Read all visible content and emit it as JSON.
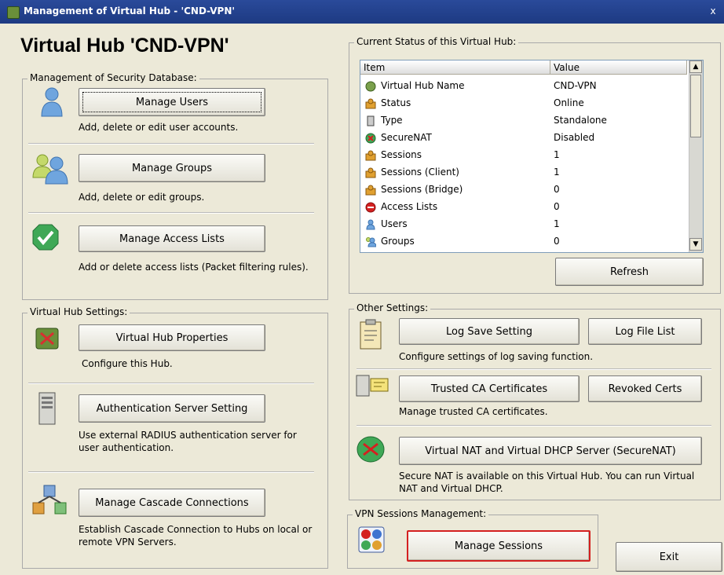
{
  "window": {
    "title": "Management of Virtual Hub - 'CND-VPN'",
    "close": "x"
  },
  "hub_title": "Virtual Hub 'CND-VPN'",
  "security": {
    "legend": "Management of Security Database:",
    "manage_users": "Manage Users",
    "manage_users_desc": "Add, delete or edit user accounts.",
    "manage_groups": "Manage Groups",
    "manage_groups_desc": "Add, delete or edit groups.",
    "manage_acl": "Manage Access Lists",
    "manage_acl_desc": "Add or delete access lists (Packet filtering rules)."
  },
  "hub_settings": {
    "legend": "Virtual Hub Settings:",
    "properties": "Virtual Hub Properties",
    "properties_desc": "Configure this Hub.",
    "auth_server": "Authentication Server Setting",
    "auth_server_desc": "Use external RADIUS authentication server for user authentication.",
    "cascade": "Manage Cascade Connections",
    "cascade_desc": "Establish Cascade Connection to Hubs on local or remote VPN Servers."
  },
  "status": {
    "legend": "Current Status of this Virtual Hub:",
    "col_item": "Item",
    "col_value": "Value",
    "rows": [
      {
        "item": "Virtual Hub Name",
        "value": "CND-VPN",
        "icon": "hub-icon"
      },
      {
        "item": "Status",
        "value": "Online",
        "icon": "status-icon"
      },
      {
        "item": "Type",
        "value": "Standalone",
        "icon": "server-icon"
      },
      {
        "item": "SecureNAT",
        "value": "Disabled",
        "icon": "securenat-icon"
      },
      {
        "item": "Sessions",
        "value": "1",
        "icon": "sessions-icon"
      },
      {
        "item": "Sessions (Client)",
        "value": "1",
        "icon": "sessions-icon"
      },
      {
        "item": "Sessions (Bridge)",
        "value": "0",
        "icon": "sessions-icon"
      },
      {
        "item": "Access Lists",
        "value": "0",
        "icon": "no-entry-icon"
      },
      {
        "item": "Users",
        "value": "1",
        "icon": "user-icon"
      },
      {
        "item": "Groups",
        "value": "0",
        "icon": "group-icon"
      }
    ],
    "refresh": "Refresh"
  },
  "other": {
    "legend": "Other Settings:",
    "log_save": "Log Save Setting",
    "log_file_list": "Log File List",
    "log_desc": "Configure settings of log saving function.",
    "trusted_ca": "Trusted CA Certificates",
    "revoked": "Revoked Certs",
    "trusted_desc": "Manage trusted CA certificates.",
    "securenat": "Virtual NAT and Virtual DHCP Server (SecureNAT)",
    "securenat_desc": "Secure NAT is available on this Virtual Hub. You can run Virtual NAT and Virtual DHCP."
  },
  "sessions": {
    "legend": "VPN Sessions Management:",
    "manage": "Manage Sessions"
  },
  "exit": "Exit"
}
